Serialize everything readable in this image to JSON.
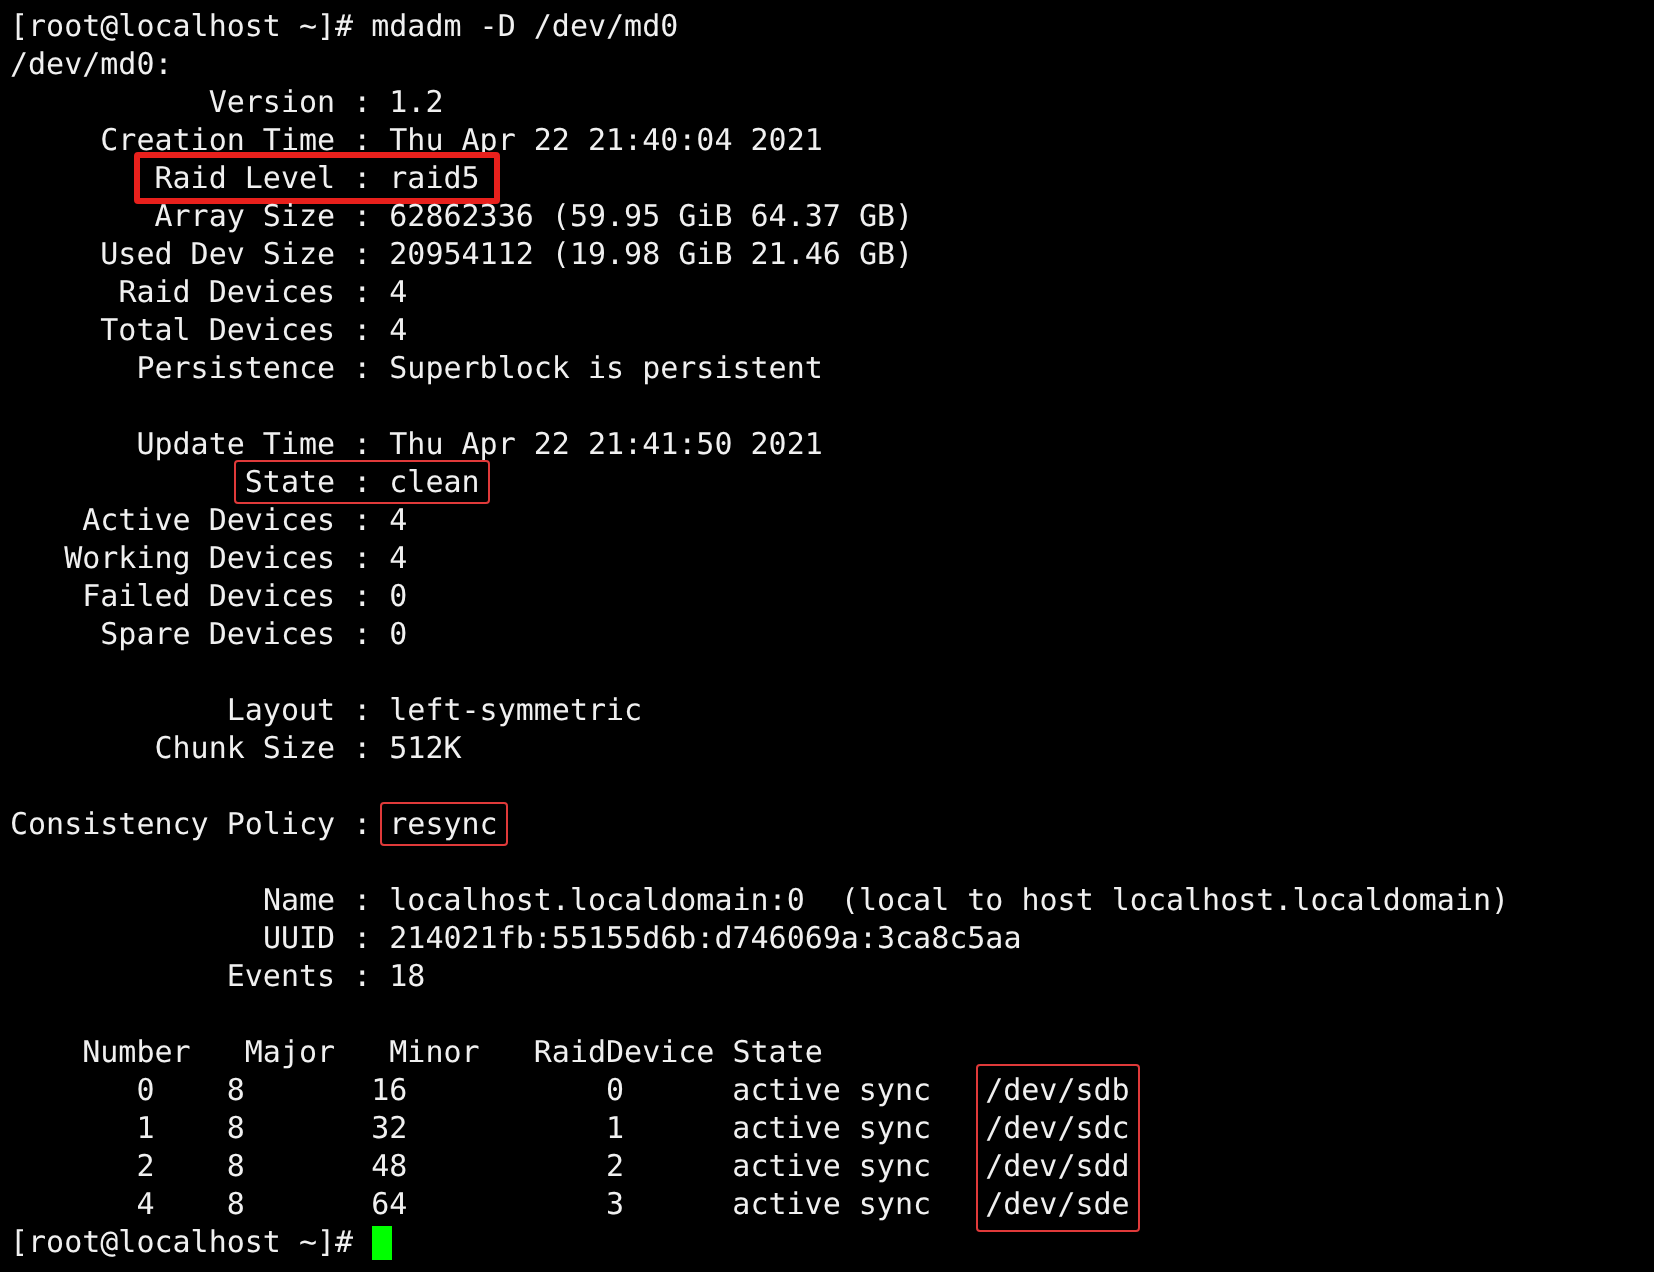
{
  "lines": [
    {
      "kind": "text",
      "segments": [
        {
          "text": "[root@localhost ~]# mdadm -D /dev/md0"
        }
      ]
    },
    {
      "kind": "text",
      "segments": [
        {
          "text": "/dev/md0:"
        }
      ]
    },
    {
      "kind": "text",
      "segments": [
        {
          "text": "           Version : 1.2"
        }
      ]
    },
    {
      "kind": "text",
      "segments": [
        {
          "text": "     Creation Time : Thu Apr 22 21:40:04 2021"
        }
      ]
    },
    {
      "kind": "text",
      "segments": [
        {
          "text": "        Raid Level : raid5",
          "kind": "heavybox"
        }
      ]
    },
    {
      "kind": "text",
      "segments": [
        {
          "text": "        Array Size : 62862336 (59.95 GiB 64.37 GB)"
        }
      ]
    },
    {
      "kind": "text",
      "segments": [
        {
          "text": "     Used Dev Size : 20954112 (19.98 GiB 21.46 GB)"
        }
      ]
    },
    {
      "kind": "text",
      "segments": [
        {
          "text": "      Raid Devices : 4"
        }
      ]
    },
    {
      "kind": "text",
      "segments": [
        {
          "text": "     Total Devices : 4"
        }
      ]
    },
    {
      "kind": "text",
      "segments": [
        {
          "text": "       Persistence : Superblock is persistent"
        }
      ]
    },
    {
      "kind": "blank"
    },
    {
      "kind": "text",
      "segments": [
        {
          "text": "       Update Time : Thu Apr 22 21:41:50 2021"
        }
      ]
    },
    {
      "kind": "text",
      "segments": [
        {
          "text": "             State : clean",
          "kind": "box"
        }
      ]
    },
    {
      "kind": "text",
      "segments": [
        {
          "text": "    Active Devices : 4"
        }
      ]
    },
    {
      "kind": "text",
      "segments": [
        {
          "text": "   Working Devices : 4"
        }
      ]
    },
    {
      "kind": "text",
      "segments": [
        {
          "text": "    Failed Devices : 0"
        }
      ]
    },
    {
      "kind": "text",
      "segments": [
        {
          "text": "     Spare Devices : 0"
        }
      ]
    },
    {
      "kind": "blank"
    },
    {
      "kind": "text",
      "segments": [
        {
          "text": "            Layout : left-symmetric"
        }
      ]
    },
    {
      "kind": "text",
      "segments": [
        {
          "text": "        Chunk Size : 512K"
        }
      ]
    },
    {
      "kind": "blank"
    },
    {
      "kind": "text",
      "segments": [
        {
          "text": "Consistency Policy : "
        },
        {
          "text": "resync",
          "kind": "box"
        }
      ]
    },
    {
      "kind": "blank"
    },
    {
      "kind": "text",
      "segments": [
        {
          "text": "              Name : localhost.localdomain:0  (local to host localhost.localdomain)"
        }
      ]
    },
    {
      "kind": "text",
      "segments": [
        {
          "text": "              UUID : 214021fb:55155d6b:d746069a:3ca8c5aa"
        }
      ]
    },
    {
      "kind": "text",
      "segments": [
        {
          "text": "            Events : 18"
        }
      ]
    },
    {
      "kind": "blank"
    }
  ],
  "device_table": {
    "header": "    Number   Major   Minor   RaidDevice State",
    "devices_highlighted": true,
    "rows": [
      {
        "number": "0",
        "major": "8",
        "minor": "16",
        "raid_device": "0",
        "state": "active sync",
        "device": "/dev/sdb"
      },
      {
        "number": "1",
        "major": "8",
        "minor": "32",
        "raid_device": "1",
        "state": "active sync",
        "device": "/dev/sdc"
      },
      {
        "number": "2",
        "major": "8",
        "minor": "48",
        "raid_device": "2",
        "state": "active sync",
        "device": "/dev/sdd"
      },
      {
        "number": "4",
        "major": "8",
        "minor": "64",
        "raid_device": "3",
        "state": "active sync",
        "device": "/dev/sde"
      }
    ]
  },
  "prompt": "[root@localhost ~]#"
}
